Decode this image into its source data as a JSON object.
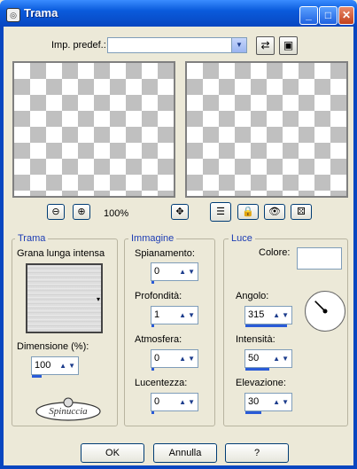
{
  "window": {
    "title": "Trama",
    "min_glyph": "_",
    "max_glyph": "□",
    "close_glyph": "✕"
  },
  "preset": {
    "label": "Imp. predef.:",
    "value": ""
  },
  "toolbar": {
    "zoom_out_glyph": "⊖",
    "zoom_in_glyph": "⊕",
    "zoom_level": "100%",
    "move_glyph": "✥",
    "copy_glyph": "⇄",
    "save_glyph": "▣"
  },
  "trama": {
    "title": "Trama",
    "texture_name": "Grana lunga intensa",
    "dimension_label": "Dimensione (%):",
    "dimension_value": "100",
    "dimension_level": 0.2
  },
  "immagine": {
    "title": "Immagine",
    "fields": [
      {
        "label": "Spianamento:",
        "value": "0",
        "level": 0
      },
      {
        "label": "Profondità:",
        "value": "1",
        "level": 0.02
      },
      {
        "label": "Atmosfera:",
        "value": "0",
        "level": 0
      },
      {
        "label": "Lucentezza:",
        "value": "0",
        "level": 0
      }
    ]
  },
  "luce": {
    "title": "Luce",
    "colore_label": "Colore:",
    "fields": [
      {
        "label": "Angolo:",
        "value": "315",
        "level": 0.875
      },
      {
        "label": "Intensità:",
        "value": "50",
        "level": 0.5
      },
      {
        "label": "Elevazione:",
        "value": "30",
        "level": 0.33
      }
    ],
    "angle_deg": 315
  },
  "buttons": {
    "ok": "OK",
    "cancel": "Annulla",
    "help": "?"
  },
  "watermark": "Spinuccia",
  "colors": {
    "accent": "#2a5bd7",
    "title_bar": "#0a5bdc",
    "group_title": "#1c3cb4"
  }
}
